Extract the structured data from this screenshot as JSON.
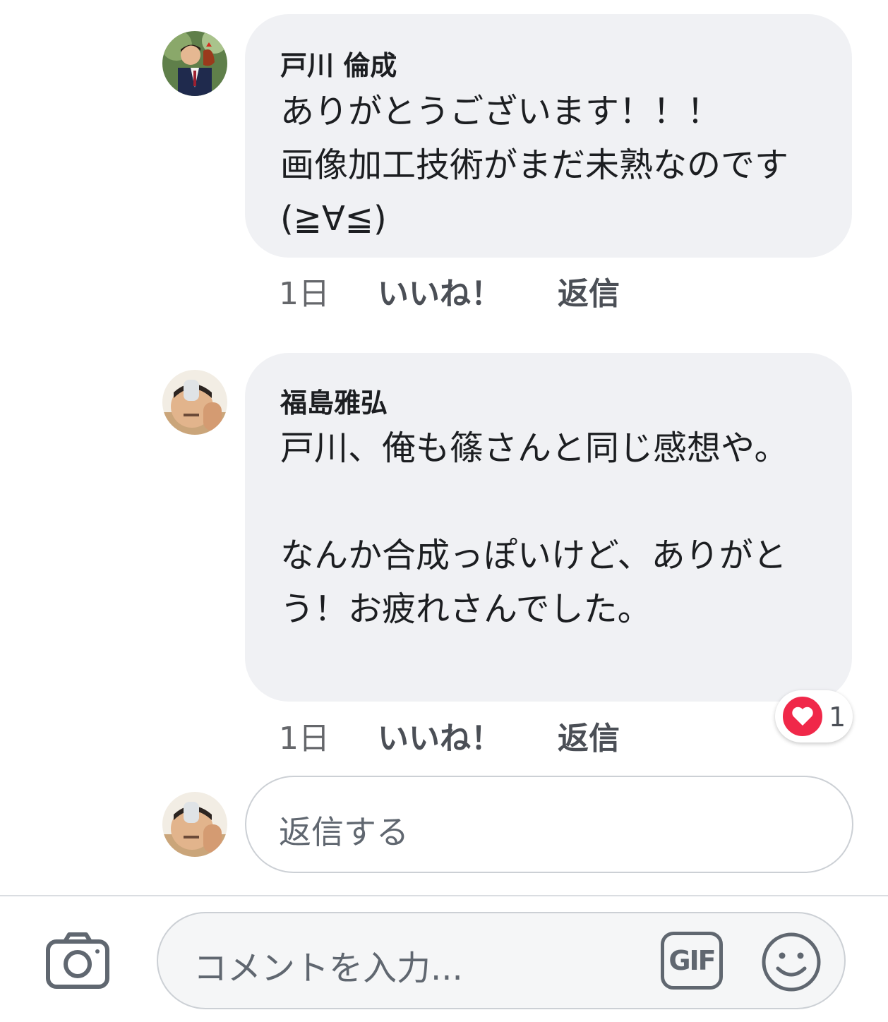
{
  "comments": [
    {
      "author": "戸川 倫成",
      "text": "ありがとうございます！！！\n画像加工技術がまだ未熟なのです(≧∀≦)",
      "time": "1日",
      "like_label": "いいね！",
      "reply_label": "返信"
    },
    {
      "author": "福島雅弘",
      "text": "戸川、俺も篠さんと同じ感想や。\n\nなんか合成っぽいけど、ありがとう！お疲れさんでした。",
      "time": "1日",
      "like_label": "いいね！",
      "reply_label": "返信",
      "reaction": {
        "icon": "heart-icon",
        "color": "#f02849",
        "count": "1"
      }
    }
  ],
  "reply_input": {
    "placeholder": "返信する"
  },
  "composer": {
    "placeholder": "コメントを入力...",
    "gif_label": "GIF",
    "camera_icon": "camera-icon",
    "emoji_icon": "smiley-icon"
  }
}
